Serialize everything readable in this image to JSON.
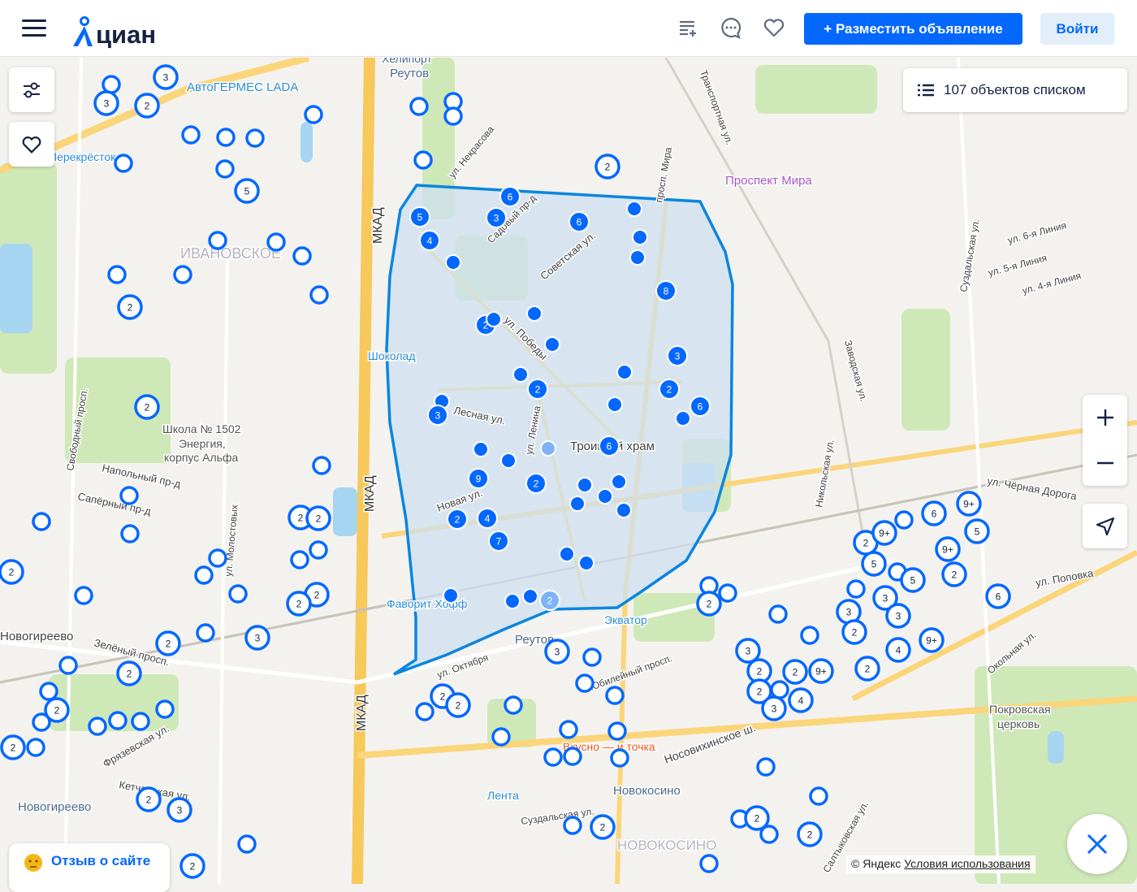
{
  "header": {
    "logo_text": "циан",
    "post_button": "+ Разместить объявление",
    "login_button": "Войти",
    "icons": [
      "menu-icon",
      "compare-list-icon",
      "chat-icon",
      "heart-icon"
    ]
  },
  "map": {
    "list_button": "107 объектов списком",
    "feedback": "Отзыв о сайте",
    "copyright": "© Яндекс",
    "terms_link": "Условия использования",
    "colors": {
      "accent": "#0468ff",
      "marker_stroke": "#0468ff",
      "polygon_fill": "#cfe0f0",
      "polygon_stroke": "#0a86e0"
    },
    "labels": {
      "l1": "Хелипорт",
      "l2": "Реутов",
      "l3": "АвтоГЕРМЕС LADA",
      "l4": "Перекрёсток",
      "l5": "ИВАНОВСКОЕ",
      "l6": "МКАД",
      "l7": "Шоколад",
      "l8": "Школа № 1502",
      "l9": "Энергия,",
      "l10": "корпус Альфа",
      "l11": "Напольный пр-д",
      "l12": "Сапёрный пр-д",
      "l13": "Свободный просп.",
      "l14": "ул. Молостовых",
      "l15": "Новогиреево",
      "l16": "Зелёный просп.",
      "l17": "Фрязевская ул.",
      "l18": "Кетчерская ул.",
      "l19": "Новогиреево",
      "l20": "Фаворит Хофф",
      "l21": "Реутов",
      "l22": "Экватор",
      "l23": "ул. Октября",
      "l24": "Юбилейный просп.",
      "l25": "Вкусно — и точка",
      "l26": "Лента",
      "l27": "Новокосино",
      "l28": "Суздальская ул.",
      "l29": "НОВОКОСИНО",
      "l30": "Носовихинское ш.",
      "l31": "Проспект Мира",
      "l32": "Транспортная ул.",
      "l33": "Заводская ул.",
      "l34": "Никольская ул.",
      "l35": "Покровская",
      "l36": "церковь",
      "l37": "Троицкий храм",
      "l38": "Лесная ул.",
      "l39": "Советская ул.",
      "l40": "ул. Победы",
      "l41": "Новая ул.",
      "l42": "ул. Некрасова",
      "l43": "просп. Мира",
      "l44": "ул. Чёрная Дорога",
      "l45": "ул. Поповка",
      "l46": "Окольная ул.",
      "l47": "ул. 6-я Линия",
      "l48": "ул. 5-я Линия",
      "l49": "ул. 4-я Линия",
      "l50": "Суздальская ул.",
      "l51": "Салтыковская ул.",
      "l52": "Садовый пр-д",
      "l53": "ул. Ленина",
      "l54": "МКАД",
      "l55": "МКАД"
    },
    "markers_outline": [
      "",
      "3",
      "3",
      "2",
      "",
      "",
      "",
      "",
      "",
      "",
      "5",
      "",
      "",
      "",
      "",
      "2",
      "",
      "",
      "",
      "",
      "",
      "",
      "2",
      "2",
      "",
      "",
      "",
      "",
      "2",
      "2",
      "",
      "",
      "",
      "2",
      "",
      "",
      "",
      "2",
      "2",
      "",
      "3",
      "2",
      "",
      "2",
      "",
      "2",
      "",
      "",
      "",
      "",
      "",
      "2",
      "",
      "2",
      "3",
      "",
      "2",
      "2",
      "2",
      "",
      "",
      "",
      "",
      "",
      "",
      "",
      "",
      "3",
      "",
      "",
      "",
      "",
      "",
      "2",
      "",
      "",
      "3",
      "2",
      "2",
      "",
      "2",
      "9+",
      "3",
      "4",
      "3",
      "2",
      "",
      "2",
      "9+",
      "",
      "5",
      "",
      "5",
      "3",
      "3",
      "4",
      "2",
      "9+",
      "6",
      "9+",
      "5",
      "9+",
      "2",
      "6",
      "",
      "",
      "",
      "2",
      "",
      "2",
      "",
      "2",
      ""
    ],
    "markers_filled": [
      "6",
      "3",
      "5",
      "4",
      "",
      "6",
      "",
      "",
      "",
      "8",
      "2",
      "",
      "",
      "",
      "",
      "2",
      "",
      "3",
      "2",
      "6",
      "",
      "",
      "",
      "3",
      "6",
      "",
      "",
      "",
      "9",
      "2",
      "",
      "",
      "",
      "",
      "",
      "2",
      "4",
      "7",
      "",
      "",
      "",
      "",
      "",
      "2"
    ]
  }
}
